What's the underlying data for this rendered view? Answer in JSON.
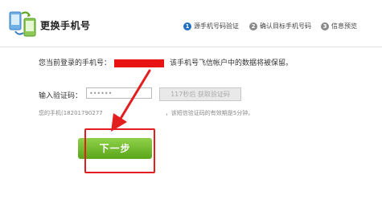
{
  "header": {
    "title": "更换手机号",
    "steps": [
      {
        "num": "1",
        "label": "源手机号码验证",
        "active": true
      },
      {
        "num": "2",
        "label": "确认目标手机号码",
        "active": false
      },
      {
        "num": "3",
        "label": "信息预览",
        "active": false
      }
    ]
  },
  "main": {
    "info_prefix": "您当前登录的手机号：",
    "info_suffix": "该手机号飞信帐户中的数据将被保留。",
    "code_label": "输入验证码：",
    "code_value": "••••••",
    "sms_button": "117秒后 获取验证码",
    "hint_prefix": "您的手机(18201790277",
    "hint_suffix": "，该短信验证码的有效期是5分钟。",
    "next_button": "下一步"
  },
  "colors": {
    "redaction": "#e81313",
    "step_active": "#1f6fc1",
    "next_button": "#6ab82a",
    "highlight_box": "#e21e1e"
  }
}
